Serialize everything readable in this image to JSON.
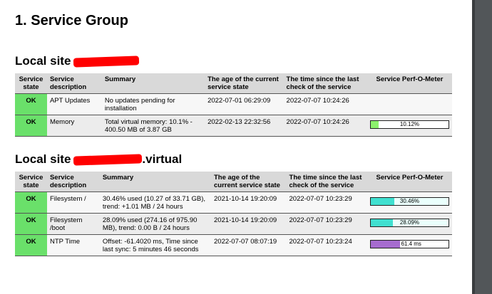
{
  "page_title": "1. Service Group",
  "headers": {
    "state": "Service state",
    "description": "Service description",
    "summary": "Summary",
    "age": "The age of the current service state",
    "check": "The time since the last check of the service",
    "perf": "Service Perf-O-Meter"
  },
  "sites": [
    {
      "prefix": "Local site",
      "suffix": "",
      "rows": [
        {
          "state": "OK",
          "description": "APT Updates",
          "summary": "No updates pending for installation",
          "age": "2022-07-01 06:29:09",
          "check": "2022-07-07 10:24:26",
          "perf": null
        },
        {
          "state": "OK",
          "description": "Memory",
          "summary": "Total virtual memory: 10.1% - 400.50 MB of 3.87 GB",
          "age": "2022-02-13 22:32:56",
          "check": "2022-07-07 10:24:26",
          "perf": {
            "label": "10.12%",
            "value": 10.12,
            "color": "#8cf06c",
            "kind": "green"
          }
        }
      ]
    },
    {
      "prefix": "Local site",
      "suffix": ".virtual",
      "rows": [
        {
          "state": "OK",
          "description": "Filesystem /",
          "summary": "30.46% used (10.27 of 33.71 GB), trend: +1.01 MB / 24 hours",
          "age": "2021-10-14 19:20:09",
          "check": "2022-07-07 10:23:29",
          "perf": {
            "label": "30.46%",
            "value": 30.46,
            "color": "#40e0d0",
            "kind": "teal"
          }
        },
        {
          "state": "OK",
          "description": "Filesystem /boot",
          "summary": "28.09% used (274.16 of 975.90 MB), trend: 0.00 B / 24 hours",
          "age": "2021-10-14 19:20:09",
          "check": "2022-07-07 10:23:29",
          "perf": {
            "label": "28.09%",
            "value": 28.09,
            "color": "#40e0d0",
            "kind": "teal"
          }
        },
        {
          "state": "OK",
          "description": "NTP Time",
          "summary": "Offset: -61.4020 ms, Time since last sync: 5 minutes 46 seconds",
          "age": "2022-07-07 08:07:19",
          "check": "2022-07-07 10:23:24",
          "perf": {
            "label": "61.4 ms",
            "value": 38,
            "color": "#a66ccf",
            "kind": "purple"
          }
        }
      ]
    }
  ]
}
